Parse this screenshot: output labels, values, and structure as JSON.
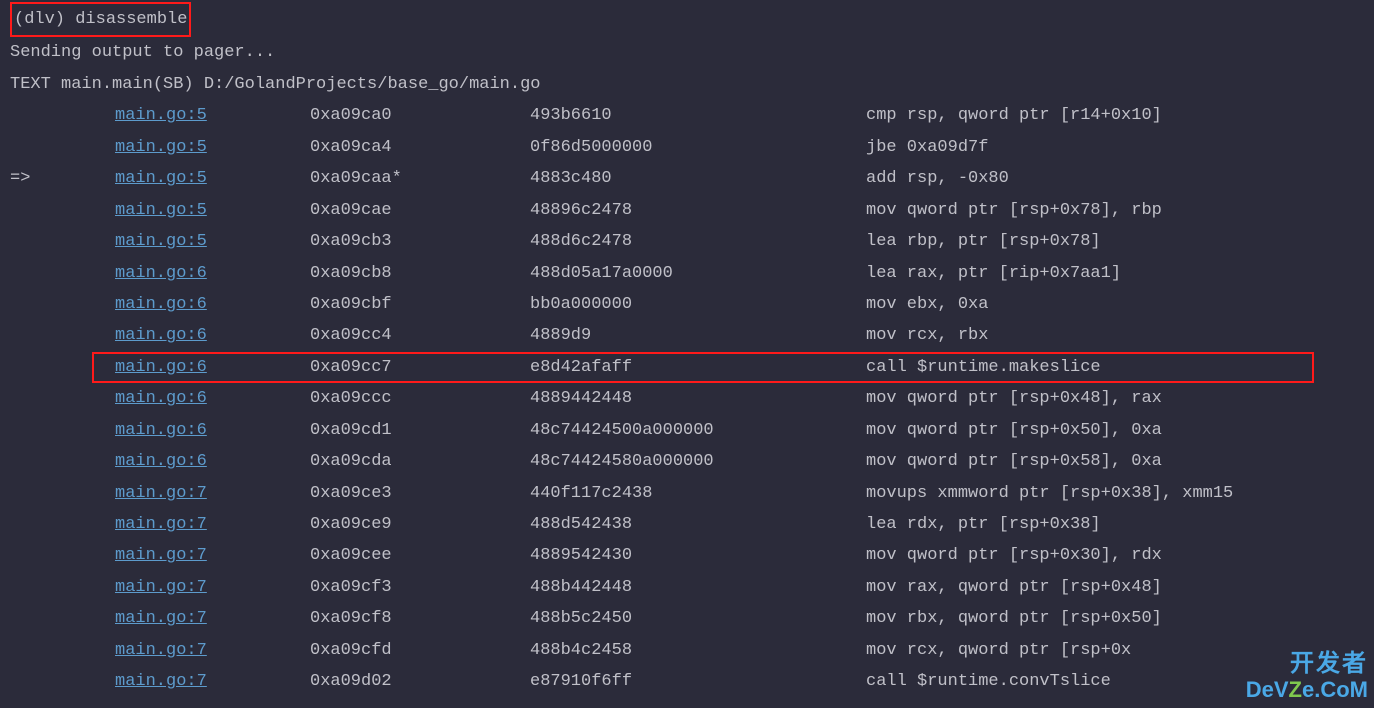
{
  "prompt": "(dlv) disassemble",
  "sending": "Sending output to pager...",
  "text_decl": "TEXT main.main(SB) D:/GolandProjects/base_go/main.go",
  "rows": [
    {
      "arrow": "",
      "src": "main.go:5",
      "addr": "0xa09ca0",
      "bytes": "493b6610",
      "asm": "cmp rsp, qword ptr [r14+0x10]",
      "hl": false
    },
    {
      "arrow": "",
      "src": "main.go:5",
      "addr": "0xa09ca4",
      "bytes": "0f86d5000000",
      "asm": "jbe 0xa09d7f",
      "hl": false
    },
    {
      "arrow": "=>",
      "src": "main.go:5",
      "addr": "0xa09caa*",
      "bytes": "4883c480",
      "asm": "add rsp, -0x80",
      "hl": false
    },
    {
      "arrow": "",
      "src": "main.go:5",
      "addr": "0xa09cae",
      "bytes": "48896c2478",
      "asm": "mov qword ptr [rsp+0x78], rbp",
      "hl": false
    },
    {
      "arrow": "",
      "src": "main.go:5",
      "addr": "0xa09cb3",
      "bytes": "488d6c2478",
      "asm": "lea rbp, ptr [rsp+0x78]",
      "hl": false
    },
    {
      "arrow": "",
      "src": "main.go:6",
      "addr": "0xa09cb8",
      "bytes": "488d05a17a0000",
      "asm": "lea rax, ptr [rip+0x7aa1]",
      "hl": false
    },
    {
      "arrow": "",
      "src": "main.go:6",
      "addr": "0xa09cbf",
      "bytes": "bb0a000000",
      "asm": "mov ebx, 0xa",
      "hl": false
    },
    {
      "arrow": "",
      "src": "main.go:6",
      "addr": "0xa09cc4",
      "bytes": "4889d9",
      "asm": "mov rcx, rbx",
      "hl": false
    },
    {
      "arrow": "",
      "src": "main.go:6",
      "addr": "0xa09cc7",
      "bytes": "e8d42afaff",
      "asm": "call $runtime.makeslice",
      "hl": true
    },
    {
      "arrow": "",
      "src": "main.go:6",
      "addr": "0xa09ccc",
      "bytes": "4889442448",
      "asm": "mov qword ptr [rsp+0x48], rax",
      "hl": false
    },
    {
      "arrow": "",
      "src": "main.go:6",
      "addr": "0xa09cd1",
      "bytes": "48c74424500a000000",
      "asm": "mov qword ptr [rsp+0x50], 0xa",
      "hl": false
    },
    {
      "arrow": "",
      "src": "main.go:6",
      "addr": "0xa09cda",
      "bytes": "48c74424580a000000",
      "asm": "mov qword ptr [rsp+0x58], 0xa",
      "hl": false
    },
    {
      "arrow": "",
      "src": "main.go:7",
      "addr": "0xa09ce3",
      "bytes": "440f117c2438",
      "asm": "movups xmmword ptr [rsp+0x38], xmm15",
      "hl": false
    },
    {
      "arrow": "",
      "src": "main.go:7",
      "addr": "0xa09ce9",
      "bytes": "488d542438",
      "asm": "lea rdx, ptr [rsp+0x38]",
      "hl": false
    },
    {
      "arrow": "",
      "src": "main.go:7",
      "addr": "0xa09cee",
      "bytes": "4889542430",
      "asm": "mov qword ptr [rsp+0x30], rdx",
      "hl": false
    },
    {
      "arrow": "",
      "src": "main.go:7",
      "addr": "0xa09cf3",
      "bytes": "488b442448",
      "asm": "mov rax, qword ptr [rsp+0x48]",
      "hl": false
    },
    {
      "arrow": "",
      "src": "main.go:7",
      "addr": "0xa09cf8",
      "bytes": "488b5c2450",
      "asm": "mov rbx, qword ptr [rsp+0x50]",
      "hl": false
    },
    {
      "arrow": "",
      "src": "main.go:7",
      "addr": "0xa09cfd",
      "bytes": "488b4c2458",
      "asm": "mov rcx, qword ptr [rsp+0x",
      "hl": false
    },
    {
      "arrow": "",
      "src": "main.go:7",
      "addr": "0xa09d02",
      "bytes": "e87910f6ff",
      "asm": "call $runtime.convTslice",
      "hl": false
    }
  ],
  "watermark": {
    "cn": "开发者",
    "domain_prefix": "De",
    "domain_v": "V",
    "domain_z": "Z",
    "domain_suffix": "e.CoM"
  }
}
